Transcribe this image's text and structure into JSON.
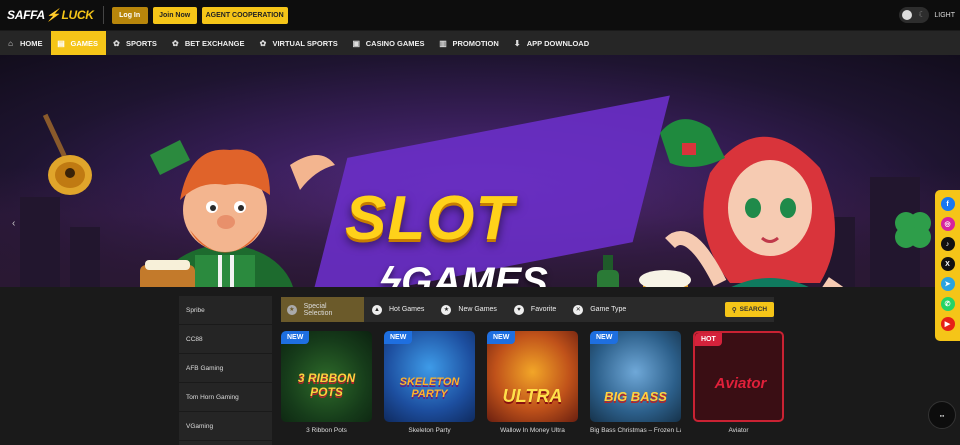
{
  "brand": {
    "name_left": "SAFFA",
    "name_right": "LUCK"
  },
  "header": {
    "login_label": "Log In",
    "join_label": "Join Now",
    "agent_label": "AGENT COOPERATION",
    "theme_label": "LIGHT"
  },
  "nav": {
    "items": [
      {
        "label": "HOME",
        "icon": "home-icon"
      },
      {
        "label": "GAMES",
        "icon": "slot-icon"
      },
      {
        "label": "SPORTS",
        "icon": "gear-icon"
      },
      {
        "label": "BET EXCHANGE",
        "icon": "gear-icon"
      },
      {
        "label": "VIRTUAL SPORTS",
        "icon": "gear-icon"
      },
      {
        "label": "CASINO GAMES",
        "icon": "cards-icon"
      },
      {
        "label": "PROMOTION",
        "icon": "gift-icon"
      },
      {
        "label": "APP DOWNLOAD",
        "icon": "download-icon"
      }
    ],
    "active": "GAMES"
  },
  "banner": {
    "line1": "SLOT",
    "line2": "GAMES"
  },
  "providers": [
    "Spribe",
    "CC88",
    "AFB Gaming",
    "Tom Horn Gaming",
    "VGaming"
  ],
  "tabs": {
    "items": [
      "Special Selection",
      "Hot Games",
      "New Games",
      "Favorite",
      "Game Type"
    ],
    "search_label": "SEARCH"
  },
  "games": [
    {
      "badge": "NEW",
      "title": "3 Ribbon Pots",
      "art": "3 RIBBON POTS"
    },
    {
      "badge": "NEW",
      "title": "Skeleton Party",
      "art": "SKELETON PARTY"
    },
    {
      "badge": "NEW",
      "title": "Wallow In Money Ultra",
      "art": "ULTRA"
    },
    {
      "badge": "NEW",
      "title": "Big Bass Christmas – Frozen La...",
      "art": "BIG BASS"
    },
    {
      "badge": "HOT",
      "title": "Aviator",
      "art": "Aviator"
    }
  ],
  "social": [
    "facebook-icon",
    "instagram-icon",
    "tiktok-icon",
    "x-icon",
    "telegram-icon",
    "whatsapp-icon",
    "youtube-icon"
  ],
  "colors": {
    "accent": "#f5c518",
    "new_badge": "#1e6fe0",
    "hot_badge": "#d4223b"
  }
}
